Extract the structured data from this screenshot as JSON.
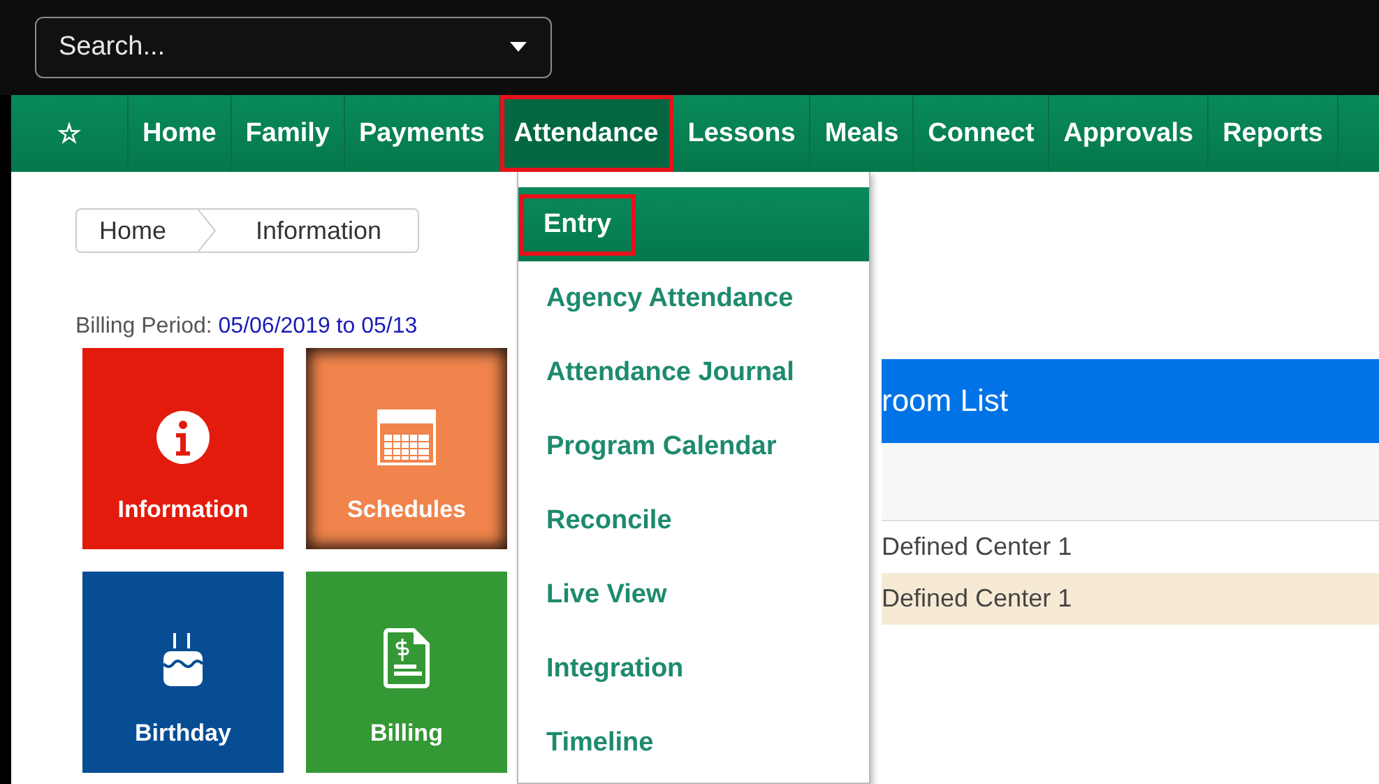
{
  "search": {
    "placeholder": "Search..."
  },
  "nav": {
    "items": [
      {
        "kind": "icon",
        "label": "☆",
        "selected": false
      },
      {
        "kind": "text",
        "label": "Home",
        "selected": false
      },
      {
        "kind": "text",
        "label": "Family",
        "selected": false
      },
      {
        "kind": "text",
        "label": "Payments",
        "selected": false
      },
      {
        "kind": "text",
        "label": "Attendance",
        "selected": true
      },
      {
        "kind": "text",
        "label": "Lessons",
        "selected": false
      },
      {
        "kind": "text",
        "label": "Meals",
        "selected": false
      },
      {
        "kind": "text",
        "label": "Connect",
        "selected": false
      },
      {
        "kind": "text",
        "label": "Approvals",
        "selected": false
      },
      {
        "kind": "text",
        "label": "Reports",
        "selected": false
      }
    ]
  },
  "dropdown": {
    "items": [
      {
        "label": "Entry",
        "selected": true
      },
      {
        "label": "Agency Attendance",
        "selected": false
      },
      {
        "label": "Attendance Journal",
        "selected": false
      },
      {
        "label": "Program Calendar",
        "selected": false
      },
      {
        "label": "Reconcile",
        "selected": false
      },
      {
        "label": "Live View",
        "selected": false
      },
      {
        "label": "Integration",
        "selected": false
      },
      {
        "label": "Timeline",
        "selected": false
      }
    ]
  },
  "breadcrumb": [
    "Home",
    "Information"
  ],
  "billing_period": {
    "label": "Billing Period:",
    "value": "05/06/2019 to 05/13"
  },
  "tiles": [
    {
      "kind": "info",
      "label": "Information",
      "color": "#e31b0c",
      "highlighted": false
    },
    {
      "kind": "calendar",
      "label": "Schedules",
      "color": "#f0844c",
      "highlighted": true
    },
    {
      "kind": "cake",
      "label": "Birthday",
      "color": "#064d94",
      "highlighted": false
    },
    {
      "kind": "bill",
      "label": "Billing",
      "color": "#349834",
      "highlighted": false
    }
  ],
  "panel": {
    "title": "room List",
    "rows": [
      {
        "cell": "Defined Center 1",
        "selected": false
      },
      {
        "cell": "Defined Center 1",
        "selected": true
      }
    ]
  }
}
